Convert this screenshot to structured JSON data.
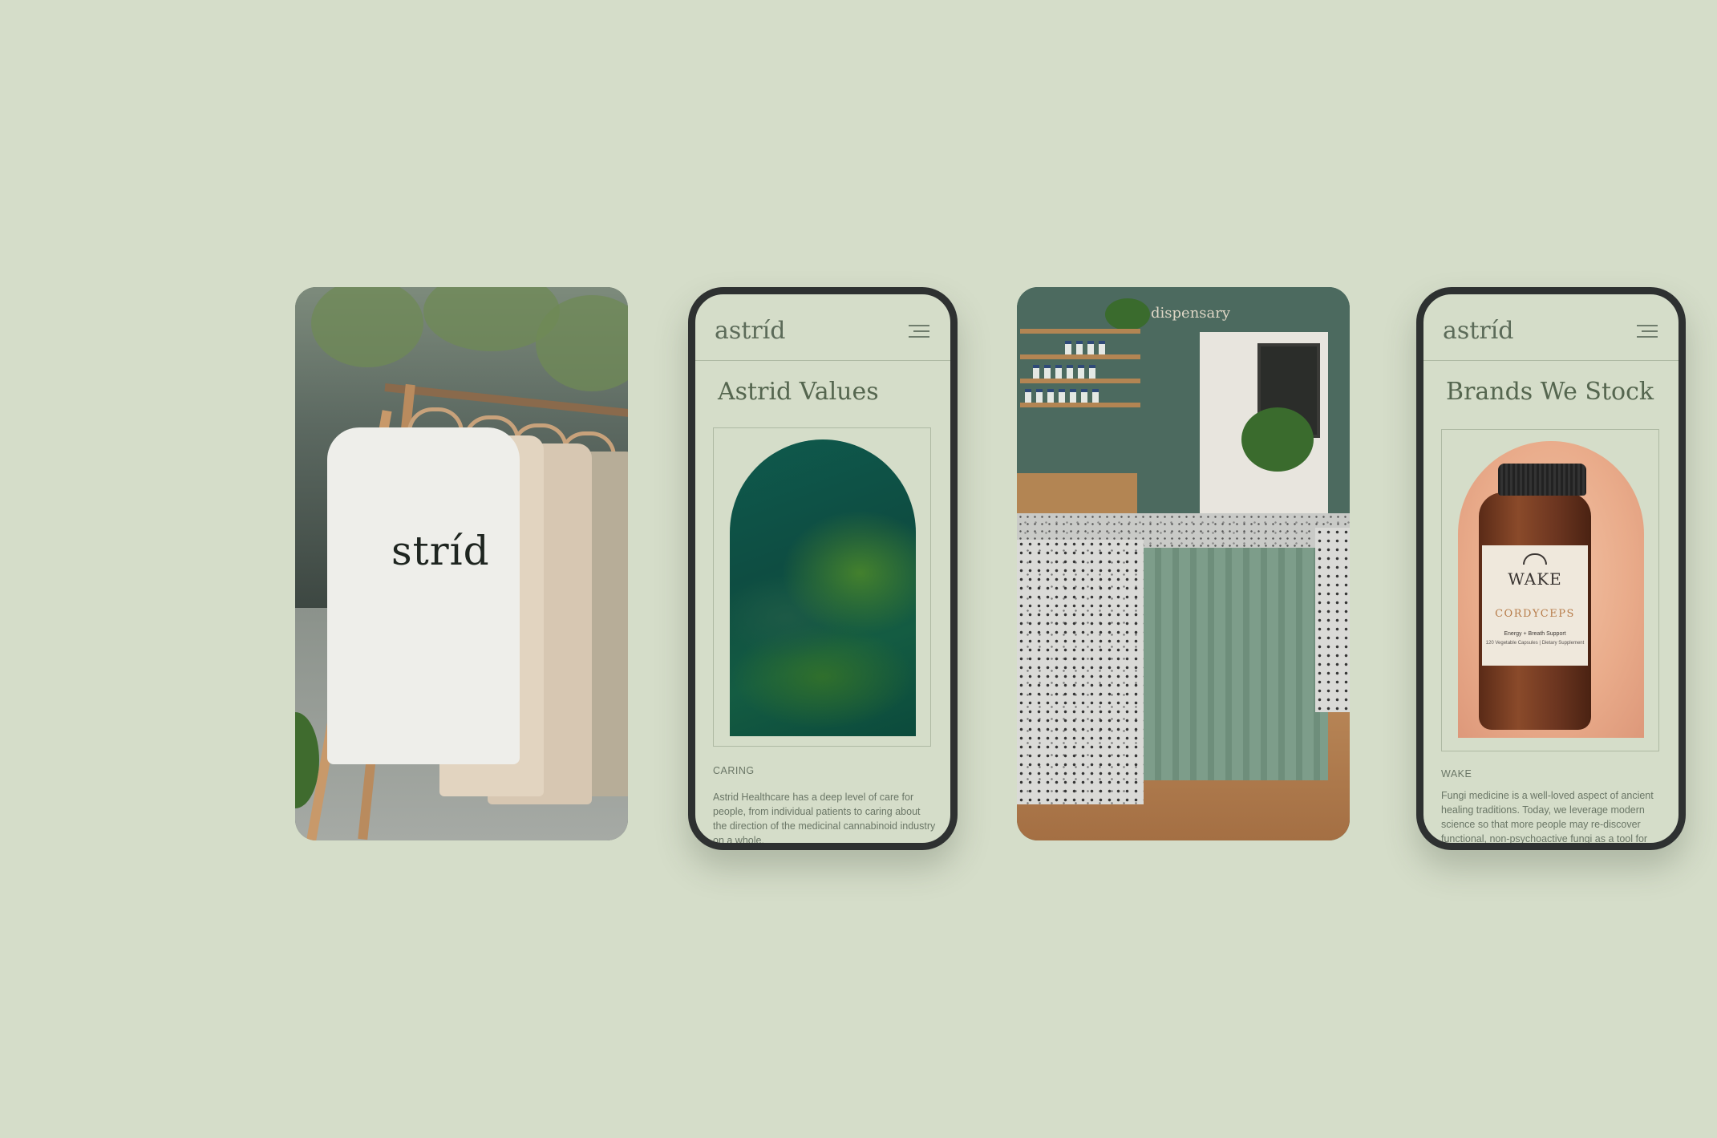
{
  "phone_values": {
    "logo": "astríd",
    "title": "Astrid Values",
    "caption": "CARING",
    "body": "Astrid Healthcare has a deep level of care for people, from individual patients to caring about the direction of the medicinal cannabinoid industry on a whole."
  },
  "phone_brands": {
    "logo": "astríd",
    "title": "Brands We Stock",
    "caption": "WAKE",
    "body": "Fungi medicine is a well-loved aspect of ancient healing traditions. Today, we leverage modern science so that more people may re-discover functional, non-psychoactive fungi as a tool for good",
    "product": {
      "brand": "WAKE",
      "name": "CORDYCEPS",
      "tagline": "Energy + Breath Support",
      "detail": "120 Vegetable Capsules | Dietary Supplement"
    }
  },
  "photo_shirts": {
    "shirt_print": "stríd"
  },
  "photo_dispensary": {
    "sign": "dispensary"
  },
  "colors": {
    "background": "#d5ddc9",
    "phone_frame": "#2e3131",
    "accent_text": "#55664f"
  },
  "icons": [
    "hamburger-menu-icon"
  ]
}
